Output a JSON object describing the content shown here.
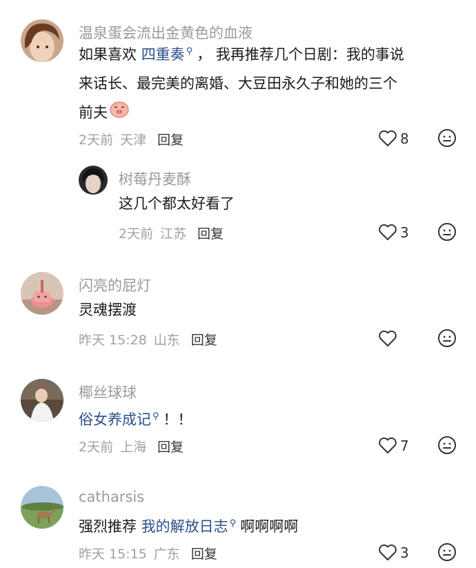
{
  "comments": [
    {
      "user": "温泉蛋会流出金黄色的血液",
      "line1_pre": "如果喜欢 ",
      "line1_link": "四重奏",
      "line1_post": "， 我再推荐几个日剧：我的事说",
      "line2": "来话长、最完美的离婚、大豆田永久子和她的三个",
      "line3": "前夫",
      "emoji": "pig-face-emoji",
      "time": "2天前",
      "location": "天津",
      "reply": "回复",
      "likes": "8",
      "avatar_colors": {
        "bg": "#c9a88e",
        "hair": "#6b3a22",
        "face": "#f1d3bd"
      }
    },
    {
      "user": "树莓丹麦酥",
      "text": "这几个都太好看了",
      "time": "2天前",
      "location": "江苏",
      "reply": "回复",
      "likes": "3"
    },
    {
      "user": "闪亮的屁灯",
      "text": "灵魂摆渡",
      "time": "昨天 15:28",
      "location": "山东",
      "reply": "回复",
      "likes": ""
    },
    {
      "user": "椰丝球球",
      "text_link": "俗女养成记",
      "text_post": "！！",
      "time": "2天前",
      "location": "上海",
      "reply": "回复",
      "likes": "7"
    },
    {
      "user": "catharsis",
      "text_pre": "强烈推荐 ",
      "text_link": "我的解放日志",
      "text_post": "啊啊啊啊",
      "time": "昨天 15:15",
      "location": "广东",
      "reply": "回复",
      "likes": "3"
    }
  ],
  "icons": {
    "like": "heart-outline-icon",
    "dislike": "meh-face-icon",
    "search": "search-mark-icon"
  },
  "colors": {
    "link": "#2a4f8c",
    "muted": "#9a9a9a",
    "text": "#1a1a1a"
  }
}
